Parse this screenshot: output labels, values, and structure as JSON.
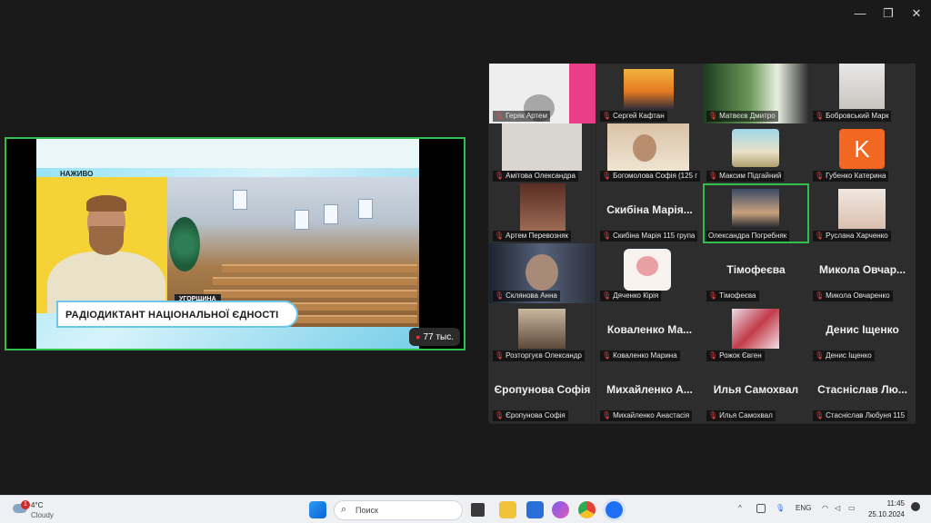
{
  "window": {
    "minimize": "—",
    "restore": "❐",
    "close": "✕"
  },
  "share": {
    "live_label": "НАЖИВО",
    "location": "УГОРЩИНА",
    "banner": "РАДІОДИКТАНТ НАЦІОНАЛЬНОЇ ЄДНОСТІ",
    "viewers": "77 тыс."
  },
  "participants": [
    {
      "name": "Геряк Артем",
      "big": ""
    },
    {
      "name": "Сергей Кафтан",
      "big": ""
    },
    {
      "name": "Матвєєв Дмитро",
      "big": ""
    },
    {
      "name": "Бобровський Марк",
      "big": ""
    },
    {
      "name": "Амітова Олександра",
      "big": ""
    },
    {
      "name": "Богомолова Софія (125 г",
      "big": ""
    },
    {
      "name": "Максим Підгайний",
      "big": ""
    },
    {
      "name": "Губенко Катерина",
      "big": ""
    },
    {
      "name": "Артем Перевозняк",
      "big": ""
    },
    {
      "name": "Скибіна Марія 115 група",
      "big": "Скибіна Марія..."
    },
    {
      "name": "Олександра Погребняк",
      "big": ""
    },
    {
      "name": "Руслана Харченко",
      "big": ""
    },
    {
      "name": "Склянова Анна",
      "big": ""
    },
    {
      "name": "Дяченко Кірія",
      "big": ""
    },
    {
      "name": "Тімофеєва",
      "big": "Тімофеєва"
    },
    {
      "name": "Микола Овчаренко",
      "big": "Микола Овчар..."
    },
    {
      "name": "Розторгуєв Олександр",
      "big": ""
    },
    {
      "name": "Коваленко Марина",
      "big": "Коваленко Ма..."
    },
    {
      "name": "Рожок Євген",
      "big": ""
    },
    {
      "name": "Денис Іщенко",
      "big": "Денис Іщенко"
    },
    {
      "name": "Єропунова Софія",
      "big": "Єропунова Софія"
    },
    {
      "name": "Михайленко Анастасія",
      "big": "Михайленко А..."
    },
    {
      "name": "Илья Самохвал",
      "big": "Илья Самохвал"
    },
    {
      "name": "Стаснiслав Любуня 115",
      "big": "Стаснiслав Лю..."
    }
  ],
  "avatar_letter": "K",
  "taskbar": {
    "weather_temp": "4°C",
    "weather_desc": "Cloudy",
    "weather_badge": "1",
    "search_placeholder": "Поиск",
    "lang": "ENG",
    "time": "11:45",
    "date": "25.10.2024"
  }
}
